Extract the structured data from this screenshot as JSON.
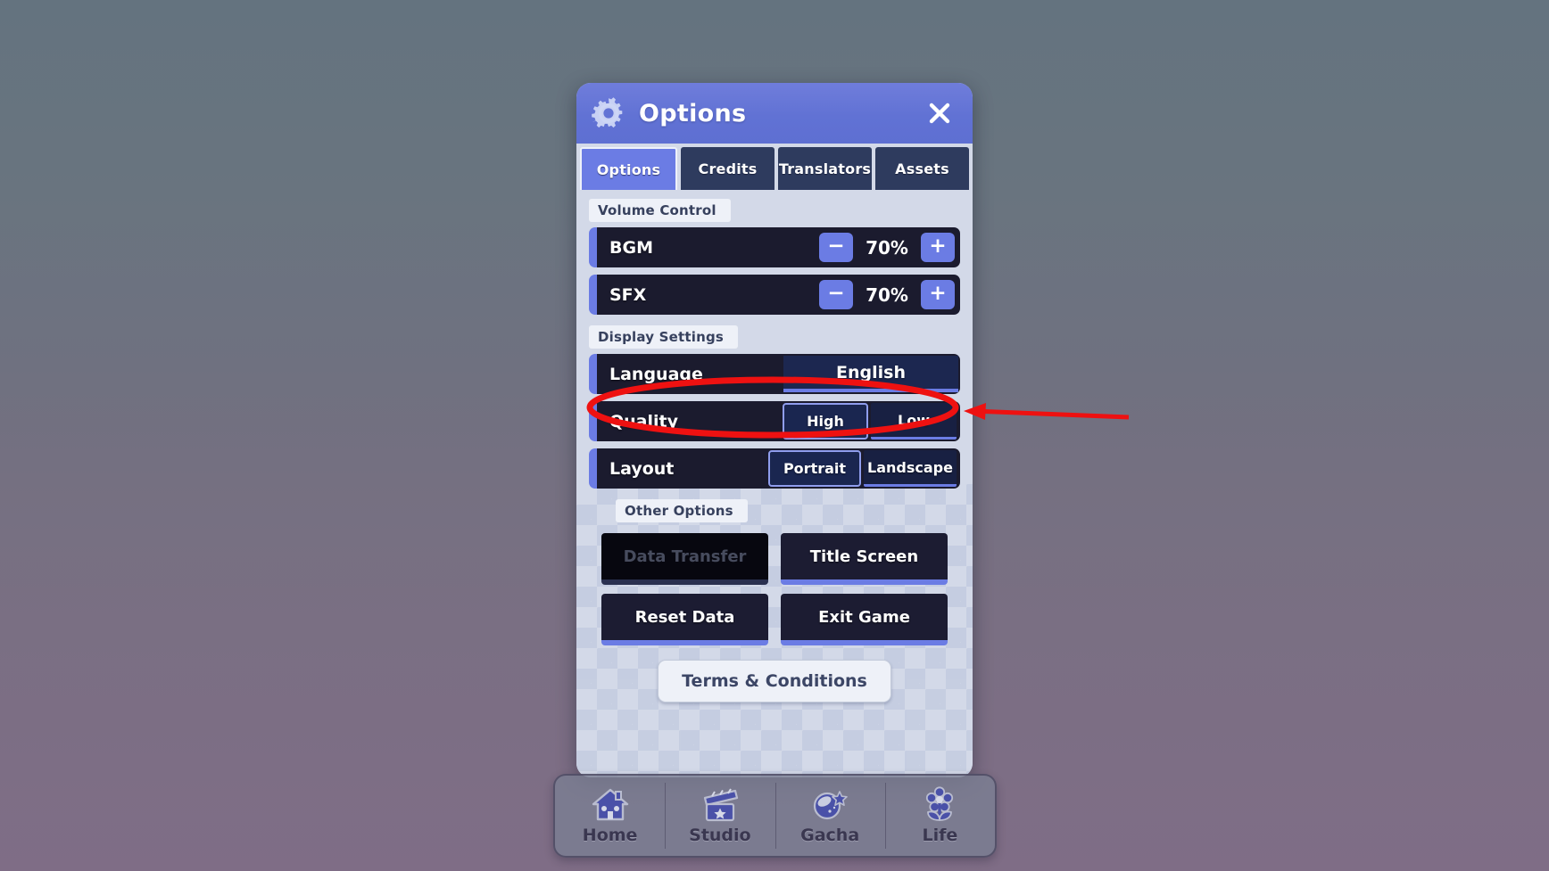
{
  "header": {
    "title": "Options",
    "gear_icon": "gear-icon",
    "close_icon": "close-icon"
  },
  "tabs": [
    {
      "label": "Options",
      "active": true
    },
    {
      "label": "Credits",
      "active": false
    },
    {
      "label": "Translators",
      "active": false
    },
    {
      "label": "Assets",
      "active": false
    }
  ],
  "sections": {
    "volume": {
      "label": "Volume Control",
      "rows": [
        {
          "label": "BGM",
          "value": "70%",
          "minus": "−",
          "plus": "+"
        },
        {
          "label": "SFX",
          "value": "70%",
          "minus": "−",
          "plus": "+"
        }
      ]
    },
    "display": {
      "label": "Display Settings",
      "language": {
        "label": "Language",
        "value": "English"
      },
      "quality": {
        "label": "Quality",
        "options": [
          {
            "label": "High",
            "selected": true
          },
          {
            "label": "Low",
            "selected": false
          }
        ]
      },
      "layout": {
        "label": "Layout",
        "options": [
          {
            "label": "Portrait",
            "selected": true
          },
          {
            "label": "Landscape",
            "selected": false
          }
        ]
      }
    },
    "other": {
      "label": "Other Options",
      "buttons": [
        {
          "label": "Data Transfer",
          "disabled": true
        },
        {
          "label": "Title Screen",
          "disabled": false
        },
        {
          "label": "Reset Data",
          "disabled": false
        },
        {
          "label": "Exit Game",
          "disabled": false
        }
      ],
      "terms": "Terms & Conditions"
    }
  },
  "bottom_nav": [
    {
      "label": "Home",
      "icon": "house-icon"
    },
    {
      "label": "Studio",
      "icon": "clapperboard-icon"
    },
    {
      "label": "Gacha",
      "icon": "gacha-ball-icon"
    },
    {
      "label": "Life",
      "icon": "flower-icon"
    }
  ],
  "annotation": {
    "highlight_target": "Language",
    "color": "#ee1111",
    "shape": "ellipse-with-arrow"
  },
  "colors": {
    "accent": "#6b7ce4",
    "panel_bg": "#d3d9e8",
    "row_bg": "#1b1b2e",
    "tab_inactive": "#2e3b5e",
    "annotation_red": "#ee1111"
  }
}
